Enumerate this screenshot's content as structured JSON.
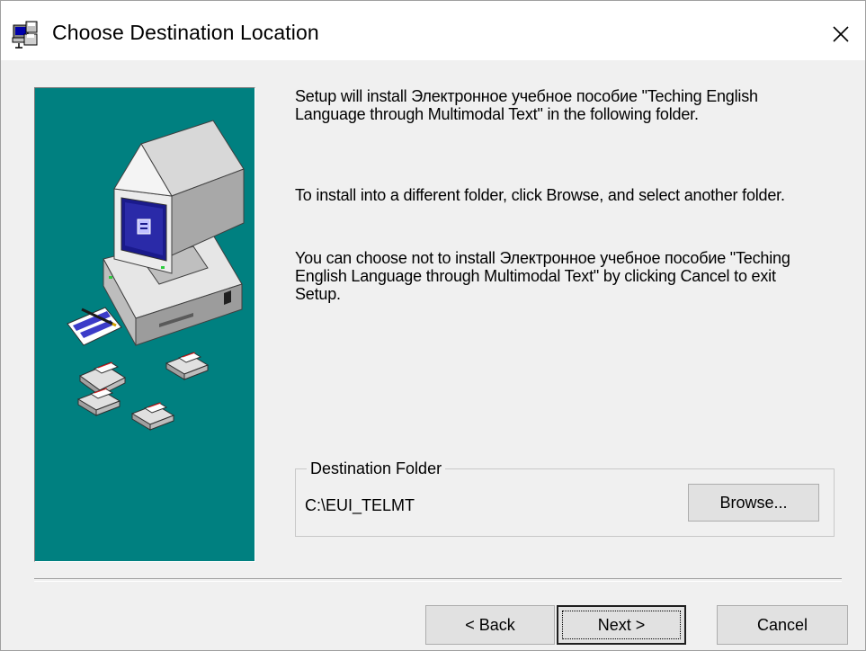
{
  "window": {
    "title": "Choose Destination Location",
    "icon": "setup-installer-icon",
    "close_icon": "close-icon"
  },
  "side_panel": {
    "background_color": "#008080",
    "illustration": "computer-with-floppy-disks-illustration"
  },
  "body": {
    "paragraph1": "Setup will install Электронное учебное пособие \"Teching English Language through Multimodal Text\" in the following folder.",
    "paragraph2": "To install into a different folder, click Browse, and select another folder.",
    "paragraph3": "You can choose not to install Электронное учебное пособие \"Teching English Language through Multimodal Text\" by clicking Cancel to exit Setup."
  },
  "destination": {
    "group_label": "Destination Folder",
    "path": "C:\\EUI_TELMT",
    "browse_label": "Browse..."
  },
  "buttons": {
    "back_label": "< Back",
    "next_label": "Next >",
    "cancel_label": "Cancel",
    "default_button": "next"
  }
}
